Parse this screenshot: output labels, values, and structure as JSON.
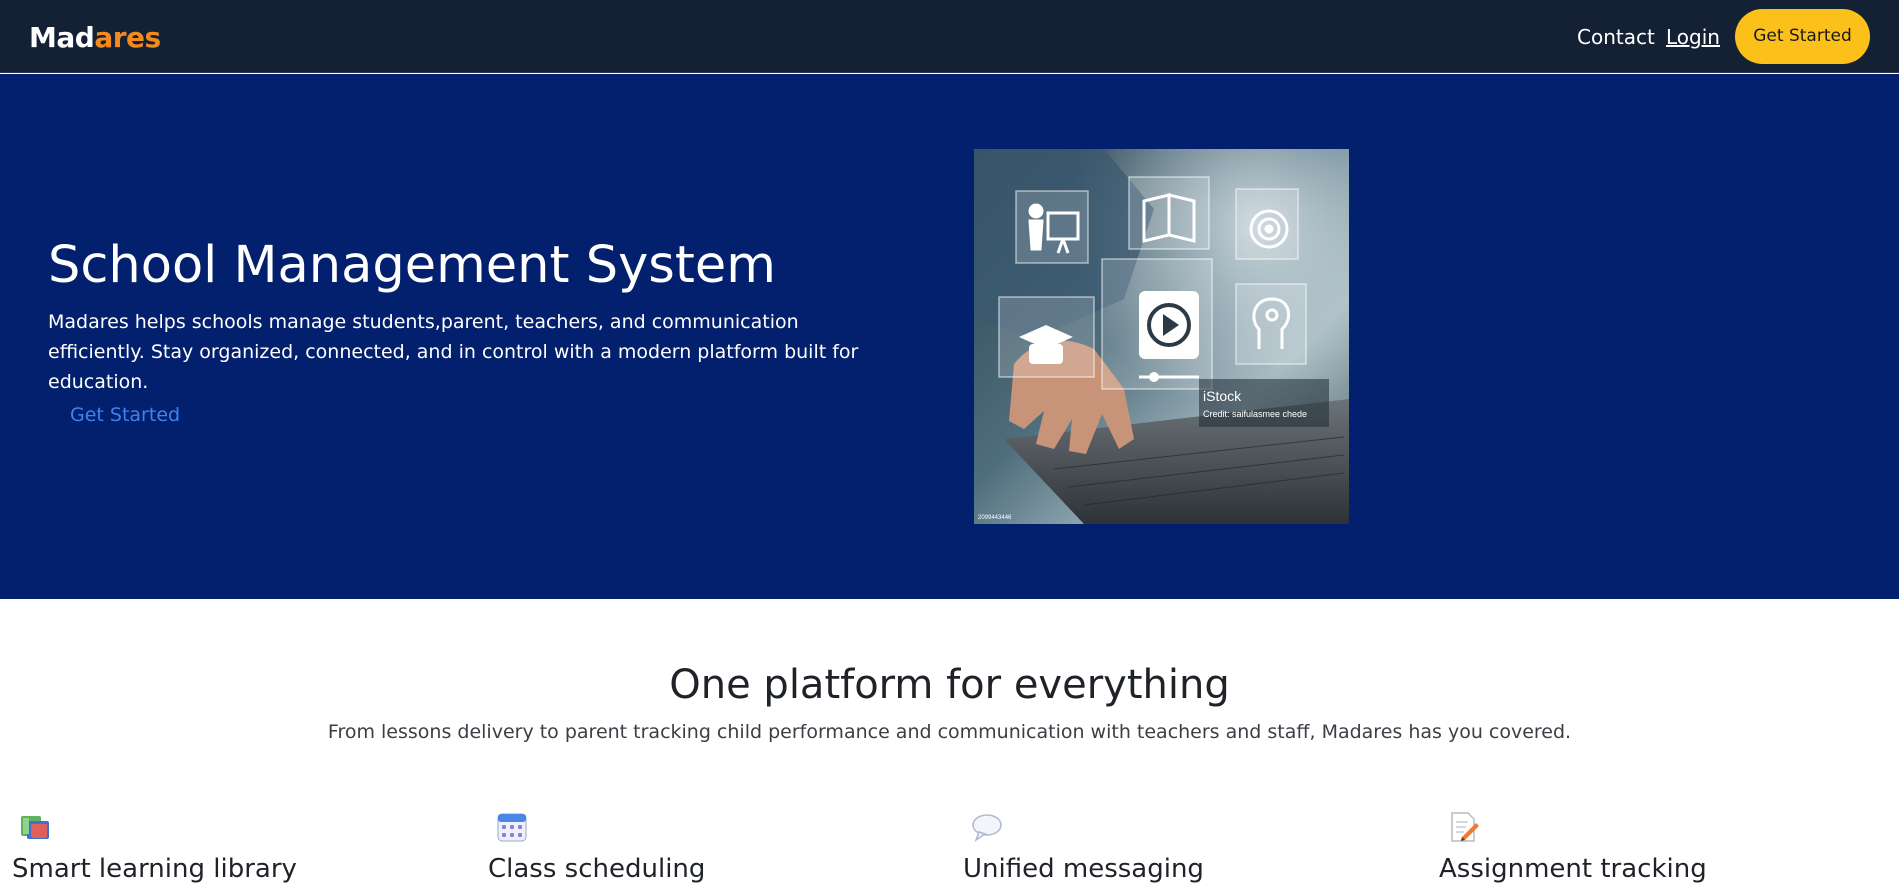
{
  "brand": {
    "name_part1": "Mad",
    "name_part2": "ares"
  },
  "nav": {
    "contact_label": "Contact",
    "login_label": "Login",
    "cta_label": "Get Started"
  },
  "hero": {
    "title": "School Management System",
    "subtitle": "Madares helps schools manage students,parent, teachers, and communication efficiently. Stay organized, connected, and in control with a modern platform built for education.",
    "cta_label": "Get Started",
    "image": {
      "watermark": "iStock",
      "credit": "Credit: saifulasmee chede",
      "image_id": "2099443446"
    }
  },
  "features": {
    "title": "One platform for everything",
    "subtitle": "From lessons delivery to parent tracking child performance and communication with teachers and staff, Madares has you covered.",
    "items": [
      {
        "icon": "books-icon",
        "title": "Smart learning library"
      },
      {
        "icon": "calendar-icon",
        "title": "Class scheduling"
      },
      {
        "icon": "speech-bubble-icon",
        "title": "Unified messaging"
      },
      {
        "icon": "memo-icon",
        "title": "Assignment tracking"
      }
    ]
  },
  "colors": {
    "navbar_bg": "#142033",
    "hero_bg": "#02206d",
    "accent_orange": "#f28a1e",
    "cta_yellow": "#fcc01a",
    "link_blue": "#3f82ee"
  }
}
